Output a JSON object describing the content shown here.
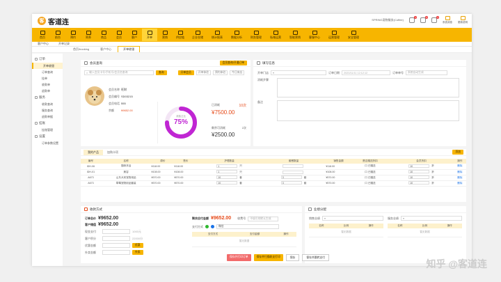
{
  "app": {
    "logo_text": "客道连",
    "logo_mark": "客",
    "shop_name": "SPRING宠物服务(Coffee)"
  },
  "top_right": {
    "badges": [
      "3",
      "8",
      "0"
    ],
    "btn1": "系统消息",
    "btn2": "更新说明"
  },
  "nav": [
    "首页",
    "前台",
    "预约",
    "寄养",
    "商品",
    "会员",
    "客户",
    "开单",
    "营销",
    "供应链",
    "企业仓储",
    "统计报表",
    "数据分析",
    "财务管理",
    "私域运营",
    "智能营销",
    "客服中心",
    "运营管理",
    "安全管理"
  ],
  "nav_active": 7,
  "subtabs": [
    "客户中心",
    "开单记录"
  ],
  "page_tabs": [
    "首页/booking",
    "客户中心",
    "开单收银"
  ],
  "page_tab_active": 2,
  "sidebar": {
    "groups": [
      {
        "label": "订单",
        "items": [
          "开单收银",
          "订单查询",
          "挂单",
          "收款单",
          "退款单"
        ]
      },
      {
        "label": "服务",
        "items": [
          "收款查询",
          "服务查询",
          "退款单据"
        ]
      },
      {
        "label": "挂账",
        "items": [
          "挂账管理"
        ]
      },
      {
        "label": "设置",
        "items": [
          "订单参数设置"
        ]
      }
    ]
  },
  "member": {
    "title": "会员查询",
    "open_card_btn": "会员查询/开通订单",
    "search_placeholder": "输入会员卡号/手机号/会员名查询",
    "search_btn": "查询",
    "pills": [
      "开单会员",
      "开单体验",
      "预约体验",
      "今日来店"
    ],
    "name_label": "会员名称",
    "name": "旺财",
    "no_label": "会员编号",
    "no": "SD03215",
    "phone_label": "会员电话",
    "phone": "555",
    "balance_label": "余额",
    "balance": "¥9652.00",
    "ring_label": "消费占比",
    "ring_pct": "75%",
    "ring_value": 0.75,
    "used_label": "已消耗",
    "used_count": "10次",
    "used_amount": "¥7500.00",
    "left_label": "剩余可消耗",
    "left_count": "2次",
    "left_amount": "¥2500.00"
  },
  "order_info": {
    "title": "填写信息",
    "store_label": "开单门店",
    "date_label": "订单日期",
    "date_value": "2020/11/11 12:12:12",
    "order_no_label": "订单单号",
    "order_no_placeholder": "系统自动生成",
    "flow_label": "消耗步骤",
    "note_label": "备注"
  },
  "product_tabs": [
    "我的产品",
    "加购卡项"
  ],
  "product_add": "添加",
  "product_columns": [
    "编号",
    "名称",
    "原价",
    "售价",
    "护理数量",
    "套餐数量",
    "销售金额",
    "是否赠送折扣",
    "会员折扣",
    "操作"
  ],
  "products": [
    {
      "id": "IDH-06",
      "name": "猫咪沐浴",
      "orig": "¥118.00",
      "price": "¥118.00",
      "qty": "1",
      "unit": "只",
      "pkg": "",
      "pkg_unit": "",
      "amount": "¥118.00",
      "gift": "口 已赠送",
      "disc": "10",
      "disc_unit": "折",
      "op": "删除"
    },
    {
      "id": "IDH-01",
      "name": "美容",
      "orig": "¥108.00",
      "price": "¥108.00",
      "qty": "1",
      "unit": "只",
      "pkg": "",
      "pkg_unit": "",
      "amount": "¥108.00",
      "gift": "口 已赠送",
      "disc": "10",
      "disc_unit": "折",
      "op": "删除"
    },
    {
      "id": "A673",
      "name": "山东犬来宠物用品",
      "orig": "¥570.00",
      "price": "¥570.00",
      "qty": "10",
      "unit": "套",
      "pkg": "3",
      "pkg_unit": "套",
      "amount": "¥570.00",
      "gift": "口 已赠送",
      "disc": "10",
      "disc_unit": "折",
      "op": "删除"
    },
    {
      "id": "A673",
      "name": "草莓宠物用品套装",
      "orig": "¥570.00",
      "price": "¥570.00",
      "qty": "10",
      "unit": "套",
      "pkg": "3",
      "pkg_unit": "套",
      "amount": "¥570.00",
      "gift": "口 已赠送",
      "disc": "10",
      "disc_unit": "折",
      "op": "删除"
    }
  ],
  "payment": {
    "title": "收款方式",
    "total_label": "订单总价",
    "total": "¥9652.00",
    "member_pay_label": "客户储值",
    "member_pay": "¥9652.00",
    "rows": [
      {
        "label": "现金支付",
        "value": "",
        "hint": "1000元"
      },
      {
        "label": "客户积分",
        "value": "",
        "hint": "22000分"
      },
      {
        "label": "优惠金额",
        "value": "",
        "btn": "优惠"
      },
      {
        "label": "外卖金额",
        "value": "",
        "btn": "外卖"
      }
    ],
    "remain_label": "剩余应付金额",
    "remain": "¥9652.00",
    "cashier_label": "收费号",
    "cashier_placeholder": "不填写则默认生成",
    "method_label": "支付方式",
    "method_value": "微信",
    "cols": [
      "支付方式",
      "支付金额",
      "操作"
    ],
    "empty": "暂无数据"
  },
  "commission": {
    "title": "业绩分配",
    "left_label": "销售业绩",
    "right_label": "服务业绩",
    "cols": [
      "名称",
      "比例",
      "操作"
    ],
    "empty": "暂无数据"
  },
  "footer": {
    "btn1": "保存并打印订单",
    "btn2": "保存并扫描收支打印",
    "btn3": "保存",
    "btn4": "保存并跳转支付"
  },
  "watermark": "知乎 @客道连",
  "colors": {
    "brand": "#f7b500",
    "ring": "#c026d3",
    "price": "#e64a19"
  }
}
